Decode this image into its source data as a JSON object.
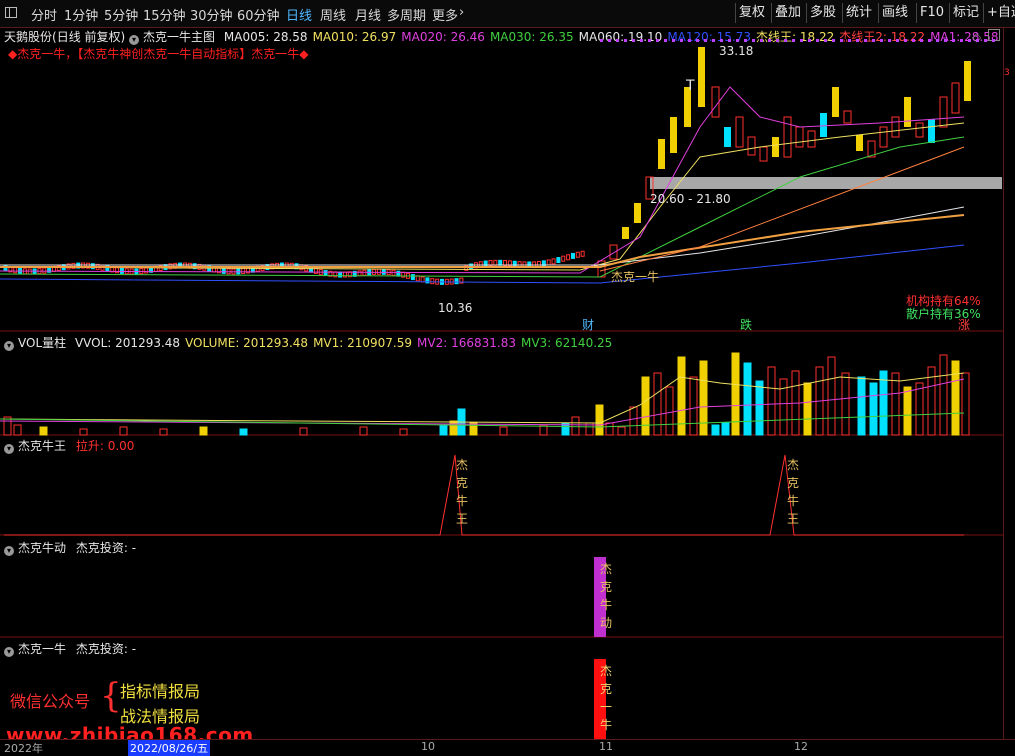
{
  "toolbar": {
    "left_icon": "sidebar-toggle-icon",
    "periods": [
      "分时",
      "1分钟",
      "5分钟",
      "15分钟",
      "30分钟",
      "60分钟",
      "日线",
      "周线",
      "月线",
      "多周期",
      "更多"
    ],
    "active_period": "日线",
    "right_buttons": [
      "复权",
      "叠加",
      "多股",
      "统计",
      "画线",
      "F10",
      "标记",
      "+自选"
    ]
  },
  "main_chart": {
    "stock_name": "天鹅股份",
    "mode": "(日线 前复权)",
    "indicator": "杰克一牛主图",
    "ma_items": [
      {
        "label": "MA005: 28.58",
        "color": "#e6e6e6"
      },
      {
        "label": "MA010: 26.97",
        "color": "#f0e060"
      },
      {
        "label": "MA020: 26.46",
        "color": "#e040e0"
      },
      {
        "label": "MA030: 26.35",
        "color": "#40d040"
      },
      {
        "label": "MA060: 19.10",
        "color": "#e6e6e6"
      },
      {
        "label": "MA120: 15.73",
        "color": "#3050ff"
      },
      {
        "label": "杰线王: 18.22",
        "color": "#f0e060"
      },
      {
        "label": "杰线王2: 18.22",
        "color": "#ff4040"
      },
      {
        "label": "MA1: 28.58",
        "color": "#e040e0"
      }
    ],
    "banner": "◆杰克一牛，【杰克牛神创杰克一牛自动指标】杰克一牛◆",
    "high_label": "33.18",
    "low_label": "10.36",
    "range_label": "20.60 - 21.80",
    "signal_label": "杰克一牛",
    "t_marker": "T",
    "markers": [
      {
        "text": "财",
        "color": "#4fb8ff"
      },
      {
        "text": "跌",
        "color": "#40e060"
      },
      {
        "text": "涨",
        "color": "#ff4040"
      }
    ],
    "holdings": [
      {
        "text": "机构持有64%",
        "color": "#ff3030"
      },
      {
        "text": "散户持有36%",
        "color": "#40e060"
      }
    ]
  },
  "volume_panel": {
    "title": "VOL量柱",
    "items": [
      {
        "label": "VVOL: 201293.48",
        "color": "#e6e6e6"
      },
      {
        "label": "VOLUME: 201293.48",
        "color": "#f0e060"
      },
      {
        "label": "MV1: 210907.59",
        "color": "#f0e060"
      },
      {
        "label": "MV2: 166831.83",
        "color": "#e040e0"
      },
      {
        "label": "MV3: 62140.25",
        "color": "#40d040"
      }
    ]
  },
  "panel3": {
    "title": "杰克牛王",
    "item": "拉升: 0.00",
    "label1": "杰克牛王",
    "label2": "杰克牛王"
  },
  "panel4": {
    "title": "杰克牛动",
    "item": "杰克投资: -",
    "label": "杰克牛动"
  },
  "panel5": {
    "title": "杰克一牛",
    "item": "杰克投资: -",
    "label": "杰克一牛"
  },
  "watermark": {
    "left": "微信公众号",
    "line1": "指标情报局",
    "line2": "战法情报局",
    "url": "www.zhibiao168.com"
  },
  "datebar": {
    "year": "2022年",
    "cursor": "2022/08/26/五",
    "m10": "10",
    "m11": "11",
    "m12": "12"
  },
  "colors": {
    "up": "#f0d000",
    "down": "#00e0ff",
    "red": "#ff3030",
    "grid": "#7a1010"
  }
}
